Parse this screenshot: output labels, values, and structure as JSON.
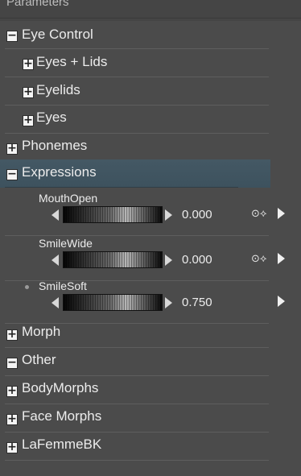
{
  "panel": {
    "top_strip_text": "Parameters"
  },
  "tree": {
    "eye_control": {
      "label": "Eye Control",
      "toggle": "−"
    },
    "eyes_lids": {
      "label": "Eyes + Lids",
      "toggle": "+"
    },
    "eyelids": {
      "label": "Eyelids",
      "toggle": "+"
    },
    "eyes": {
      "label": "Eyes",
      "toggle": "+"
    },
    "phonemes": {
      "label": "Phonemes",
      "toggle": "+"
    },
    "expressions": {
      "label": "Expressions",
      "toggle": "−"
    },
    "morph": {
      "label": "Morph",
      "toggle": "+"
    },
    "other": {
      "label": "Other",
      "toggle": "−"
    },
    "body_morphs": {
      "label": "BodyMorphs",
      "toggle": "+"
    },
    "face_morphs": {
      "label": "Face Morphs",
      "toggle": "+"
    },
    "lafemmebk": {
      "label": "LaFemmeBK",
      "toggle": "+"
    }
  },
  "dials": [
    {
      "name": "MouthOpen",
      "value": "0.000",
      "key_icon": "⊙⟡"
    },
    {
      "name": "SmileWide",
      "value": "0.000",
      "key_icon": "⊙⟡"
    },
    {
      "name": "SmileSoft",
      "value": "0.750"
    }
  ],
  "colors": {
    "panel_bg": "#4b4b4b",
    "highlight": "#445864",
    "text": "#ececec"
  }
}
